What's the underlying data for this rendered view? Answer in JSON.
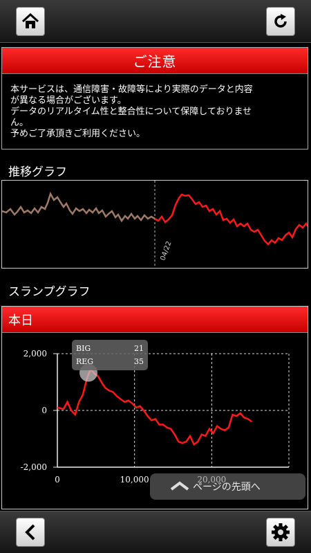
{
  "notice": {
    "title": "ご注意",
    "lines": [
      "本サービスは、通信障害・故障等により実際のデータと内容",
      "が異なる場合がございます。",
      "データのリアルタイム性と整合性について保障しておりませ",
      "ん。",
      "予めご了承頂きご利用ください。"
    ]
  },
  "trend": {
    "title": "推移グラフ",
    "date_label": "04/22",
    "past_color": "#a07a68",
    "today_color": "#ff1a1a"
  },
  "slump": {
    "title": "スランプグラフ",
    "header": "本日",
    "tooltip": {
      "big_label": "BIG",
      "big_value": "21",
      "reg_label": "REG",
      "reg_value": "35"
    }
  },
  "page_top_button": {
    "label": "ページの先頭へ"
  },
  "icons": {
    "home": "home-icon",
    "reload": "reload-icon",
    "back": "back-arrow-icon",
    "settings": "gear-icon"
  },
  "chart_data": {
    "type": "line",
    "title": "",
    "xlabel": "",
    "ylabel": "",
    "xlim": [
      0,
      30000
    ],
    "ylim": [
      -2000,
      2000
    ],
    "x_ticks": [
      "0",
      "10,000",
      "20,000"
    ],
    "y_ticks": [
      "2,000",
      "0",
      "-2,000"
    ],
    "grid": true,
    "series": [
      {
        "color": "#ff1a1a",
        "x": [
          0,
          800,
          1300,
          1800,
          2300,
          2800,
          3300,
          3800,
          4300,
          4800,
          5300,
          5700,
          6200,
          6700,
          7200,
          7700,
          8200,
          8700,
          9200,
          9700,
          10200,
          10700,
          11200,
          11700,
          12200,
          12700,
          13200,
          13700,
          14200,
          14700,
          15200,
          15700,
          16200,
          16700,
          17200,
          17700,
          18200,
          18700,
          19200,
          19700,
          20200,
          20700,
          21200,
          21700,
          22200,
          22700,
          23200,
          23700,
          24200,
          24700,
          25200
        ],
        "y": [
          100,
          50,
          300,
          0,
          -150,
          300,
          550,
          1100,
          1450,
          1300,
          1200,
          1000,
          800,
          700,
          650,
          500,
          400,
          300,
          350,
          250,
          100,
          150,
          0,
          -200,
          -350,
          -300,
          -500,
          -500,
          -600,
          -650,
          -850,
          -1100,
          -1150,
          -1100,
          -900,
          -1200,
          -1100,
          -850,
          -900,
          -650,
          -800,
          -550,
          -650,
          -700,
          -600,
          -150,
          -200,
          -100,
          -250,
          -300,
          -400
        ]
      }
    ]
  }
}
